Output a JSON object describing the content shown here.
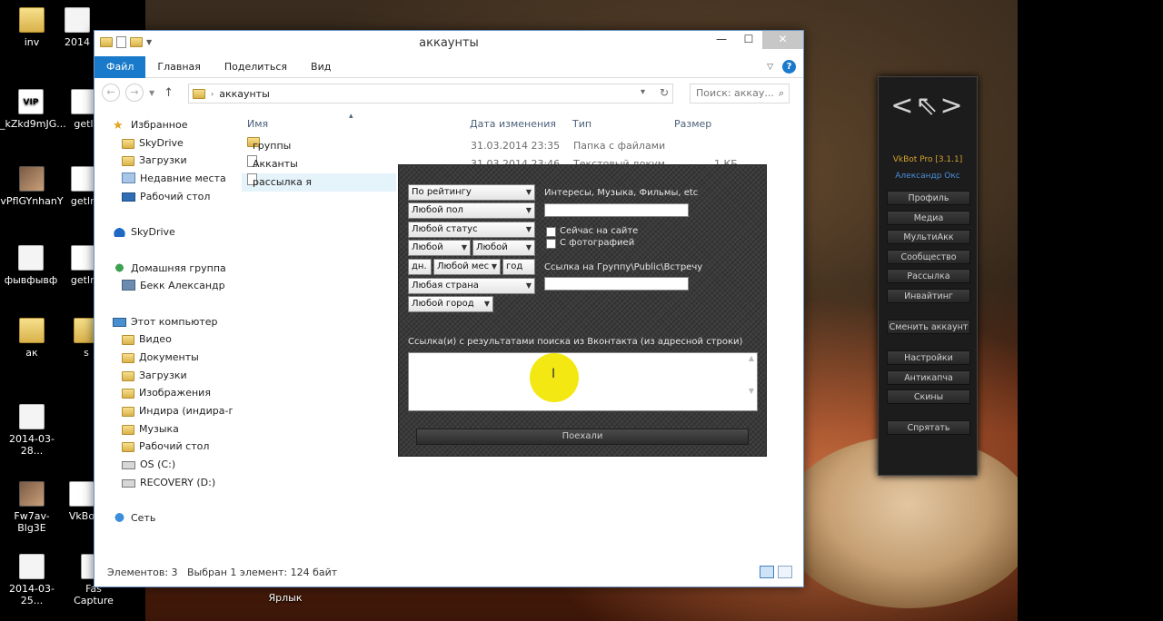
{
  "desktop": {
    "icons": [
      {
        "label": "inv"
      },
      {
        "label": "2014"
      },
      {
        "label": "_kZkd9mJG..."
      },
      {
        "label": "getI"
      },
      {
        "label": "vPflGYnhanY"
      },
      {
        "label": "getIn"
      },
      {
        "label": "фывфывф"
      },
      {
        "label": "getIn"
      },
      {
        "label": "ак"
      },
      {
        "label": "s"
      },
      {
        "label": "2014-03-28..."
      },
      {
        "label": "Fw7av-Blg3E"
      },
      {
        "label": "VkBo"
      },
      {
        "label": "2014-03-25..."
      },
      {
        "label": "Fas Capture"
      },
      {
        "label": "Ярлык"
      }
    ]
  },
  "explorer": {
    "title": "аккаунты",
    "ribbon_tabs": [
      "Файл",
      "Главная",
      "Поделиться",
      "Вид"
    ],
    "address": "аккаунты",
    "search_placeholder": "Поиск: аккау...",
    "nav": {
      "favorites": "Избранное",
      "fav_items": [
        "SkyDrive",
        "Загрузки",
        "Недавние места",
        "Рабочий стол"
      ],
      "skydrive": "SkyDrive",
      "homegroup": "Домашняя группа",
      "homegroup_user": "Бекк Александр",
      "computer": "Этот компьютер",
      "computer_items": [
        "Видео",
        "Документы",
        "Загрузки",
        "Изображения",
        "Индира (индира-пк",
        "Музыка",
        "Рабочий стол",
        "OS (C:)",
        "RECOVERY (D:)"
      ],
      "network": "Сеть"
    },
    "columns": {
      "name": "Имя",
      "date": "Дата изменения",
      "type": "Тип",
      "size": "Размер"
    },
    "files": [
      {
        "name": "группы",
        "date": "31.03.2014 23:35",
        "type": "Папка с файлами",
        "size": ""
      },
      {
        "name": "Акканты",
        "date": "31.03.2014 23:46",
        "type": "Текстовый докум...",
        "size": "1 КБ"
      },
      {
        "name": "рассылка я",
        "date": "",
        "type": "",
        "size": ""
      }
    ],
    "status": {
      "count": "Элементов: 3",
      "selection": "Выбран 1 элемент: 124 байт"
    }
  },
  "vkdialog": {
    "sort": "По рейтингу",
    "gender": "Любой пол",
    "status": "Любой статус",
    "age_from": "Любой",
    "age_to": "Любой",
    "day": "дн.",
    "month": "Любой мес",
    "year": "год",
    "country": "Любая страна",
    "city": "Любой город",
    "interests_label": "Интересы, Музыка, Фильмы, etc",
    "online_label": "Сейчас на сайте",
    "photo_label": "С фотографией",
    "group_link_label": "Ссылка на Группу\\Public\\Встречу",
    "search_links_label": "Ссылка(и) с результатами поиска из Вконтакта (из адресной строки)",
    "go_button": "Поехали"
  },
  "vkpanel": {
    "version": "VkBot Pro [3.1.1]",
    "user": "Александр Окс",
    "buttons": [
      "Профиль",
      "Медиа",
      "МультиАкк",
      "Сообщество",
      "Рассылка",
      "Инвайтинг",
      "Сменить аккаунт",
      "Настройки",
      "Антикапча",
      "Скины",
      "Спрятать"
    ]
  }
}
